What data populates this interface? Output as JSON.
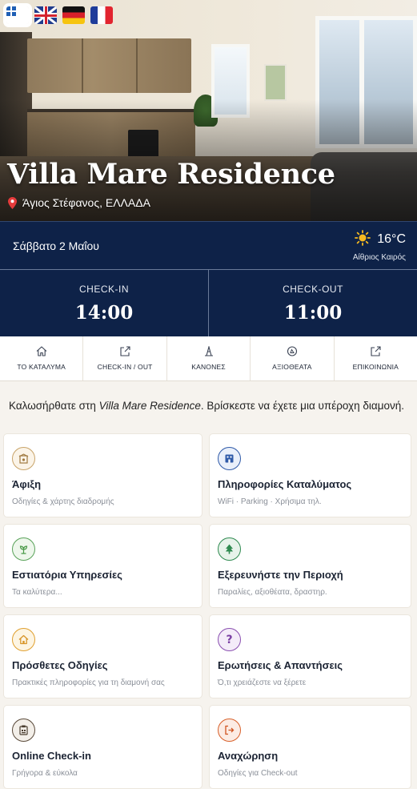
{
  "languages": [
    {
      "name": "Greek",
      "icon": "greece-flag-icon",
      "active": true
    },
    {
      "name": "English",
      "icon": "uk-flag-icon",
      "active": false
    },
    {
      "name": "German",
      "icon": "germany-flag-icon",
      "active": false
    },
    {
      "name": "French",
      "icon": "france-flag-icon",
      "active": false
    }
  ],
  "hero": {
    "title": "Villa Mare Residence",
    "location": "Άγιος Στέφανος, ΕΛΛΑΔΑ"
  },
  "weather": {
    "date": "Σάββατο 2 Μαΐου",
    "temperature": "16°C",
    "condition": "Αίθριος Καιρός"
  },
  "check": {
    "in_label": "CHECK-IN",
    "in_time": "14:00",
    "out_label": "CHECK-OUT",
    "out_time": "11:00"
  },
  "nav": [
    {
      "label": "ΤΟ ΚΑΤΑΛΥΜΑ",
      "icon": "home-icon"
    },
    {
      "label": "CHECK-IN / OUT",
      "icon": "share-arrow-icon"
    },
    {
      "label": "ΚΑΝΟΝΕΣ",
      "icon": "rules-icon"
    },
    {
      "label": "ΑΞΙΟΘΕΑΤΑ",
      "icon": "attractions-icon"
    },
    {
      "label": "ΕΠΙΚΟΙΝΩΝΙΑ",
      "icon": "contact-icon"
    }
  ],
  "welcome": {
    "prefix": "Καλωσήρθατε στη ",
    "name": "Villa Mare Residence",
    "suffix": ". Βρίσκεστε να έχετε μια υπέροχη διαμονή."
  },
  "cards": [
    {
      "title": "Άφιξη",
      "subtitle": "Οδηγίες & χάρτης διαδρομής",
      "icon": "arrival-icon",
      "color": "#c9a46a"
    },
    {
      "title": "Πληροφορίες Καταλύματος",
      "subtitle": "WiFi · Parking · Χρήσιμα τηλ.",
      "icon": "building-icon",
      "color": "#2f5aa8"
    },
    {
      "title": "Εστιατόρια Υπηρεσίες",
      "subtitle": "Τα καλύτερα...",
      "icon": "plant-icon",
      "color": "#5aa35a"
    },
    {
      "title": "Εξερευνήστε την Περιοχή",
      "subtitle": "Παραλίες, αξιοθέατα, δραστηρ.",
      "icon": "tree-icon",
      "color": "#2f8a50"
    },
    {
      "title": "Πρόσθετες Οδηγίες",
      "subtitle": "Πρακτικές πληροφορίες για τη διαμονή σας",
      "icon": "house-icon",
      "color": "#e0a030"
    },
    {
      "title": "Ερωτήσεις & Απαντήσεις",
      "subtitle": "Ό,τι χρειάζεστε να ξέρετε",
      "icon": "question-icon",
      "color": "#8a4fb0"
    },
    {
      "title": "Online Check-in",
      "subtitle": "Γρήγορα & εύκολα",
      "icon": "checkin-icon",
      "color": "#5a4a3a"
    },
    {
      "title": "Αναχώρηση",
      "subtitle": "Οδηγίες για Check-out",
      "icon": "departure-icon",
      "color": "#d8602a"
    }
  ]
}
